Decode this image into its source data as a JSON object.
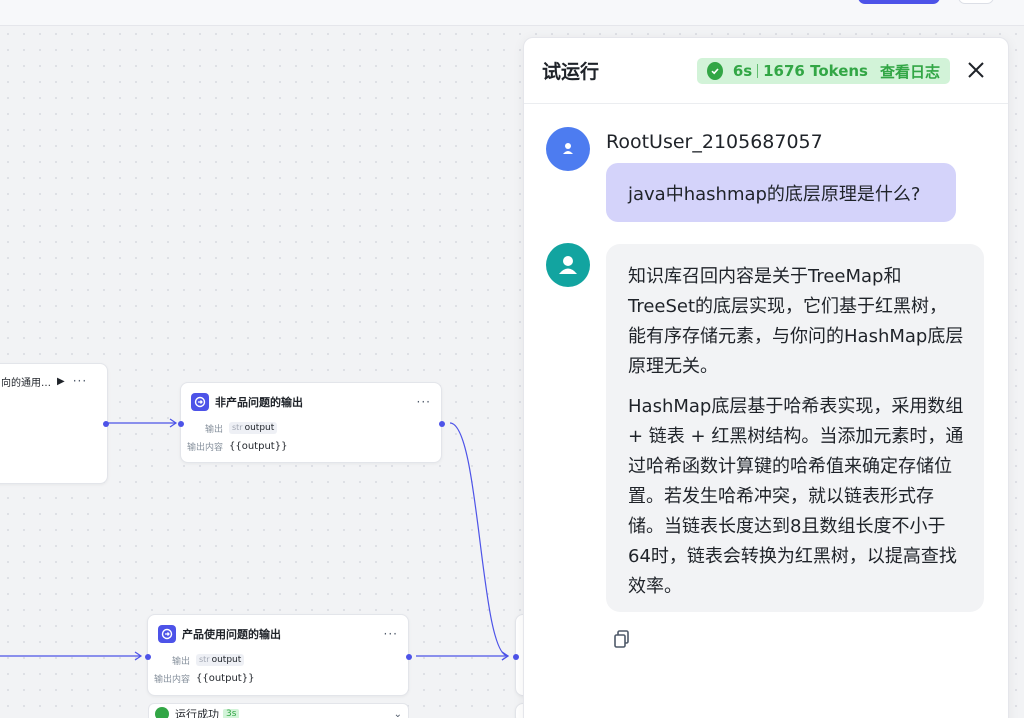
{
  "canvas": {
    "nodes": {
      "left_partial": {
        "title": "向的通用…"
      },
      "non_product": {
        "title": "非产品问题的输出",
        "output_label": "输出",
        "output_type": "str",
        "output_name": "output",
        "content_label": "输出内容",
        "content_value": "{{output}}"
      },
      "product_usage": {
        "title": "产品使用问题的输出",
        "output_label": "输出",
        "output_type": "str",
        "output_name": "output",
        "content_label": "输出内容",
        "content_value": "{{output}}"
      }
    },
    "run_status": {
      "label": "运行成功",
      "time": "3s"
    }
  },
  "panel": {
    "title": "试运行",
    "badge": {
      "time": "6s",
      "tokens": "1676 Tokens",
      "logs_label": "查看日志"
    },
    "user": {
      "name": "RootUser_2105687057",
      "message": "java中hashmap的底层原理是什么?"
    },
    "assistant": {
      "paragraphs": [
        "知识库召回内容是关于TreeMap和TreeSet的底层实现，它们基于红黑树，能有序存储元素，与你问的HashMap底层原理无关。",
        "HashMap底层基于哈希表实现，采用数组 + 链表 + 红黑树结构。当添加元素时，通过哈希函数计算键的哈希值来确定存储位置。若发生哈希冲突，就以链表形式存储。当链表长度达到8且数组长度不小于64时，链表会转换为红黑树，以提高查找效率。"
      ]
    }
  },
  "colors": {
    "accent": "#4d53e8",
    "success": "#32a645",
    "success_bg": "#d2f3d8",
    "user_bubble": "#d4d3fa",
    "bot_avatar": "#12a4a0",
    "user_avatar": "#4d7cf0"
  },
  "icons": [
    "play-icon",
    "more-icon",
    "output-node-icon",
    "check-circle-icon",
    "close-icon",
    "user-avatar-icon",
    "bot-avatar-icon",
    "copy-icon",
    "chevron-down-icon"
  ]
}
